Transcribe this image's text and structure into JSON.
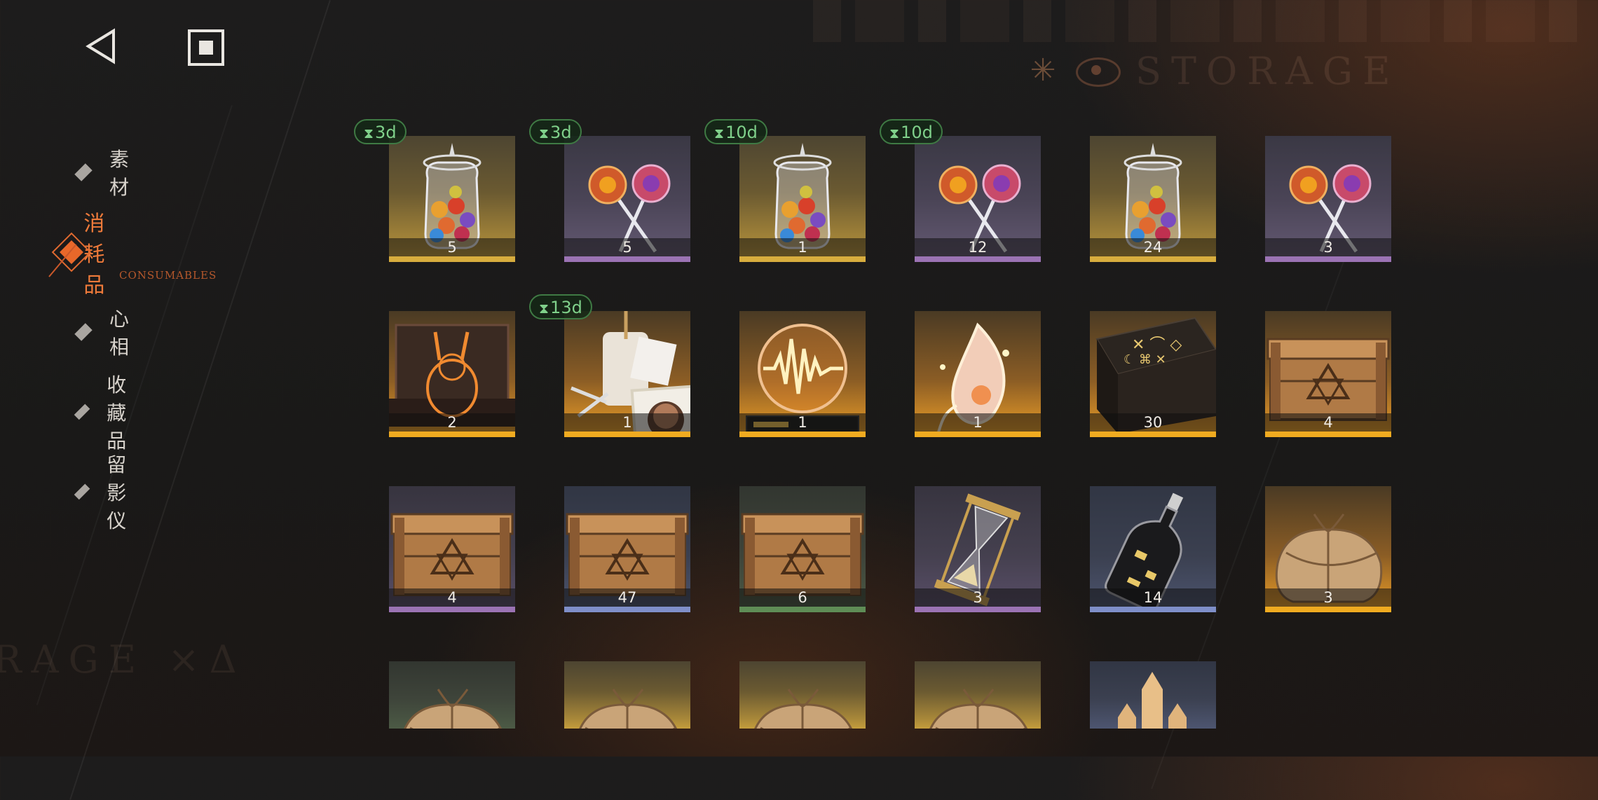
{
  "watermarks": {
    "storage": "STORAGE",
    "storage2": "RAGE ×Δ"
  },
  "nav": {
    "back": "back",
    "home": "home"
  },
  "sidebar": {
    "items": [
      {
        "label": "素材",
        "active": false
      },
      {
        "label": "消耗品",
        "active": true
      },
      {
        "label": "心相",
        "active": false
      },
      {
        "label": "收藏品",
        "active": false
      },
      {
        "label": "留影仪",
        "active": false
      }
    ],
    "active_sub": "CONSUMABLES"
  },
  "colors": {
    "accent": "#e8682a",
    "timer": "#7fd08a"
  },
  "items": [
    {
      "name": "candy-jar",
      "qty": "5",
      "rarity": "gold",
      "timer": "3d"
    },
    {
      "name": "lollipops",
      "qty": "5",
      "rarity": "purple",
      "timer": "3d"
    },
    {
      "name": "candy-jar",
      "qty": "1",
      "rarity": "gold",
      "timer": "10d"
    },
    {
      "name": "lollipops",
      "qty": "12",
      "rarity": "purple",
      "timer": "10d"
    },
    {
      "name": "candy-jar",
      "qty": "24",
      "rarity": "gold",
      "timer": ""
    },
    {
      "name": "lollipops",
      "qty": "3",
      "rarity": "purple",
      "timer": ""
    },
    {
      "name": "rabbit-figure-box",
      "qty": "2",
      "rarity": "orange",
      "timer": ""
    },
    {
      "name": "outfit-portrait",
      "qty": "1",
      "rarity": "orange",
      "timer": "13d"
    },
    {
      "name": "soundwave-orb",
      "qty": "1",
      "rarity": "orange",
      "timer": ""
    },
    {
      "name": "glowing-flower",
      "qty": "1",
      "rarity": "orange",
      "timer": ""
    },
    {
      "name": "rune-table",
      "qty": "30",
      "rarity": "orange",
      "timer": ""
    },
    {
      "name": "crate",
      "qty": "4",
      "rarity": "orange",
      "timer": ""
    },
    {
      "name": "crate",
      "qty": "4",
      "rarity": "violet",
      "timer": ""
    },
    {
      "name": "crate",
      "qty": "47",
      "rarity": "blue",
      "timer": ""
    },
    {
      "name": "crate",
      "qty": "6",
      "rarity": "green",
      "timer": ""
    },
    {
      "name": "hourglass",
      "qty": "3",
      "rarity": "violet",
      "timer": ""
    },
    {
      "name": "bottle",
      "qty": "14",
      "rarity": "blue",
      "timer": ""
    },
    {
      "name": "parcel",
      "qty": "3",
      "rarity": "orange",
      "timer": ""
    },
    {
      "name": "parcel",
      "qty": "",
      "rarity": "green",
      "timer": ""
    },
    {
      "name": "parcel",
      "qty": "",
      "rarity": "gold",
      "timer": ""
    },
    {
      "name": "parcel",
      "qty": "",
      "rarity": "gold",
      "timer": ""
    },
    {
      "name": "parcel",
      "qty": "",
      "rarity": "gold",
      "timer": ""
    },
    {
      "name": "sand-castle",
      "qty": "",
      "rarity": "blue",
      "timer": ""
    }
  ]
}
